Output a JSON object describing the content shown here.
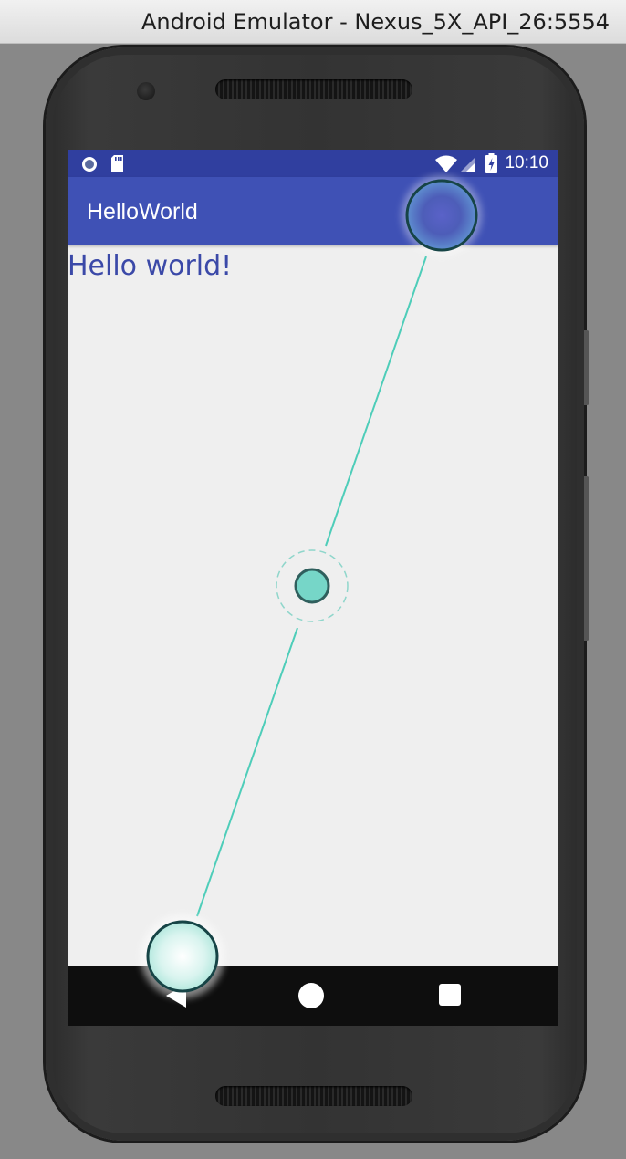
{
  "window": {
    "title": "Android Emulator - Nexus_5X_API_26:5554"
  },
  "status_bar": {
    "time": "10:10",
    "left_icons": [
      "notification-dot-icon",
      "sd-card-icon"
    ],
    "right_icons": [
      "wifi-icon",
      "cellular-signal-icon",
      "battery-charging-icon"
    ],
    "color": "#303f9f"
  },
  "app_bar": {
    "title": "HelloWorld",
    "color": "#3f51b5"
  },
  "content": {
    "text": "Hello world!",
    "text_color": "#3b49a8"
  },
  "nav_bar": {
    "buttons": [
      "back-icon",
      "home-icon",
      "recents-icon"
    ]
  },
  "gesture_overlay": {
    "type": "two-finger-pinch",
    "accent": "#4ecdb9",
    "touch_points": [
      "touch-point-top",
      "touch-point-bottom"
    ],
    "center_marker": "pinch-center-marker"
  }
}
